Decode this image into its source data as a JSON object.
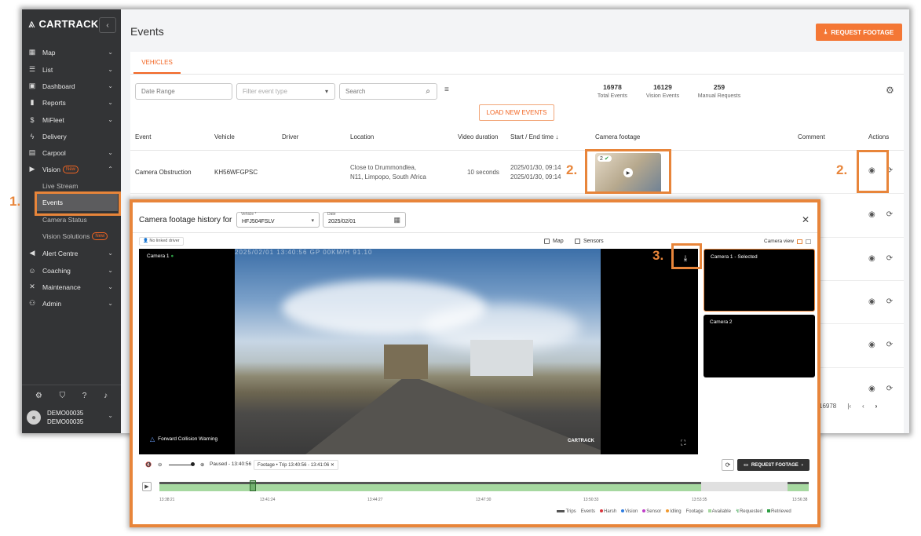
{
  "sidebar": {
    "brand": "CARTRACK",
    "items": [
      {
        "label": "Map",
        "icon": "map-icon"
      },
      {
        "label": "List",
        "icon": "list-icon"
      },
      {
        "label": "Dashboard",
        "icon": "dashboard-icon"
      },
      {
        "label": "Reports",
        "icon": "reports-icon"
      },
      {
        "label": "MiFleet",
        "icon": "dollar-icon"
      },
      {
        "label": "Delivery",
        "icon": "bolt-icon"
      },
      {
        "label": "Carpool",
        "icon": "calendar-icon"
      },
      {
        "label": "Vision",
        "icon": "camera-icon",
        "badge": "New"
      },
      {
        "label": "Alert Centre",
        "icon": "megaphone-icon"
      },
      {
        "label": "Coaching",
        "icon": "coaching-icon"
      },
      {
        "label": "Maintenance",
        "icon": "tools-icon"
      },
      {
        "label": "Admin",
        "icon": "admin-icon"
      }
    ],
    "vision_sub": {
      "live": "Live Stream",
      "events": "Events",
      "camera_status": "Camera Status",
      "solutions": "Vision Solutions",
      "solutions_badge": "New"
    },
    "user": {
      "name": "DEMO00035",
      "account": "DEMO00035"
    }
  },
  "page": {
    "title": "Events",
    "request_footage": "REQUEST FOOTAGE",
    "tab": "VEHICLES",
    "filters": {
      "date_range": "Date Range",
      "event_type": "Filter event type",
      "search": "Search"
    },
    "stats": [
      {
        "value": "16978",
        "label": "Total Events"
      },
      {
        "value": "16129",
        "label": "Vision Events"
      },
      {
        "value": "259",
        "label": "Manual Requests"
      }
    ],
    "load_new": "LOAD NEW EVENTS",
    "columns": {
      "event": "Event",
      "vehicle": "Vehicle",
      "driver": "Driver",
      "location": "Location",
      "duration": "Video duration",
      "time": "Start / End time",
      "footage": "Camera footage",
      "comment": "Comment",
      "actions": "Actions"
    },
    "row": {
      "event": "Camera Obstruction",
      "vehicle": "KH56WFGPSC",
      "location1": "Close to Drummondlea,",
      "location2": "N11, Limpopo, South Africa",
      "duration": "10 seconds",
      "start": "2025/01/30, 09:14",
      "end": "2025/01/30, 09:14",
      "footage_count": "2"
    },
    "pager_count": "16978"
  },
  "annotations": {
    "step1": "1.",
    "step2": "2.",
    "step3": "3."
  },
  "modal": {
    "title": "Camera footage history for",
    "vehicle_label": "Vehicle *",
    "vehicle": "HFJ504FSLV",
    "date_label": "Date",
    "date": "2025/02/01",
    "no_driver": "No linked driver",
    "map": "Map",
    "sensors": "Sensors",
    "camera_view": "Camera view",
    "camera1": "Camera 1",
    "timestamp": "2025/02/01 13:40:56  GP 00KM/H  91.10",
    "fcw": "Forward Collision Warning",
    "brand": "CARTRACK",
    "tile1": "Camera 1 - Selected",
    "tile2": "Camera 2",
    "paused": "Paused - 13:40:56",
    "footage_chip": "Footage • Trip  13:40:56 - 13:41:06",
    "request_footage": "REQUEST FOOTAGE",
    "ticks": [
      "13:38:21",
      "13:41:24",
      "13:44:27",
      "13:47:30",
      "13:50:33",
      "13:53:35",
      "13:56:38"
    ],
    "legend": {
      "trips": "Trips",
      "events": "Events",
      "harsh": "Harsh",
      "vision": "Vision",
      "sensor": "Sensor",
      "idling": "Idling",
      "footage": "Footage",
      "available": "Available",
      "requested": "Requested",
      "retrieved": "Retrieved"
    }
  }
}
